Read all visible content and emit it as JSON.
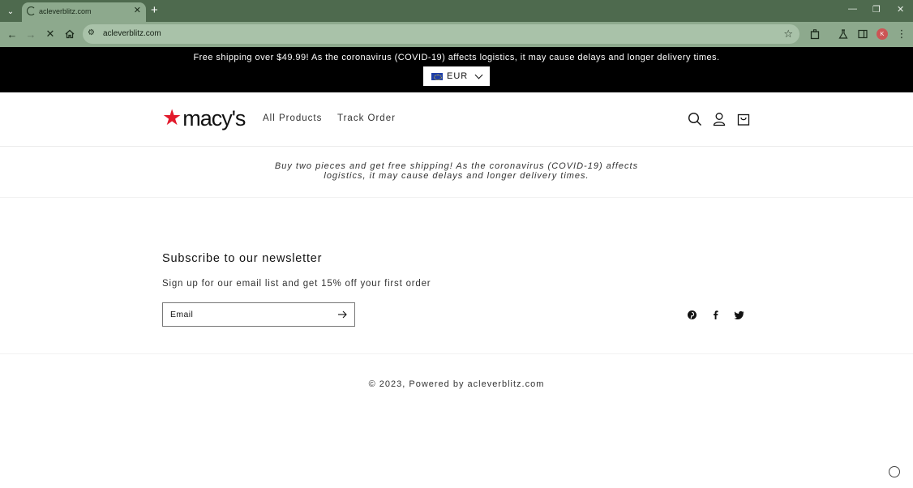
{
  "browser": {
    "tab_title": "acleverblitz.com",
    "url": "acleverblitz.com",
    "profile_initials": "K"
  },
  "announcement": {
    "text": "Free shipping over $49.99! As the coronavirus (COVID-19) affects logistics, it may cause delays and longer delivery times.",
    "currency": "EUR"
  },
  "header": {
    "logo_text": "macy's",
    "nav": [
      "All Products",
      "Track Order"
    ]
  },
  "promo": {
    "text": "Buy two pieces and get free shipping! As the coronavirus (COVID-19) affects logistics, it may cause delays and longer delivery times."
  },
  "newsletter": {
    "title": "Subscribe to our newsletter",
    "subtitle": "Sign up for our email list and get 15% off your first order",
    "email_placeholder": "Email"
  },
  "footer": {
    "copyright": "© 2023, Powered by acleverblitz.com"
  },
  "colors": {
    "brand_red": "#e21a2c",
    "chrome_green": "#8da98d"
  }
}
